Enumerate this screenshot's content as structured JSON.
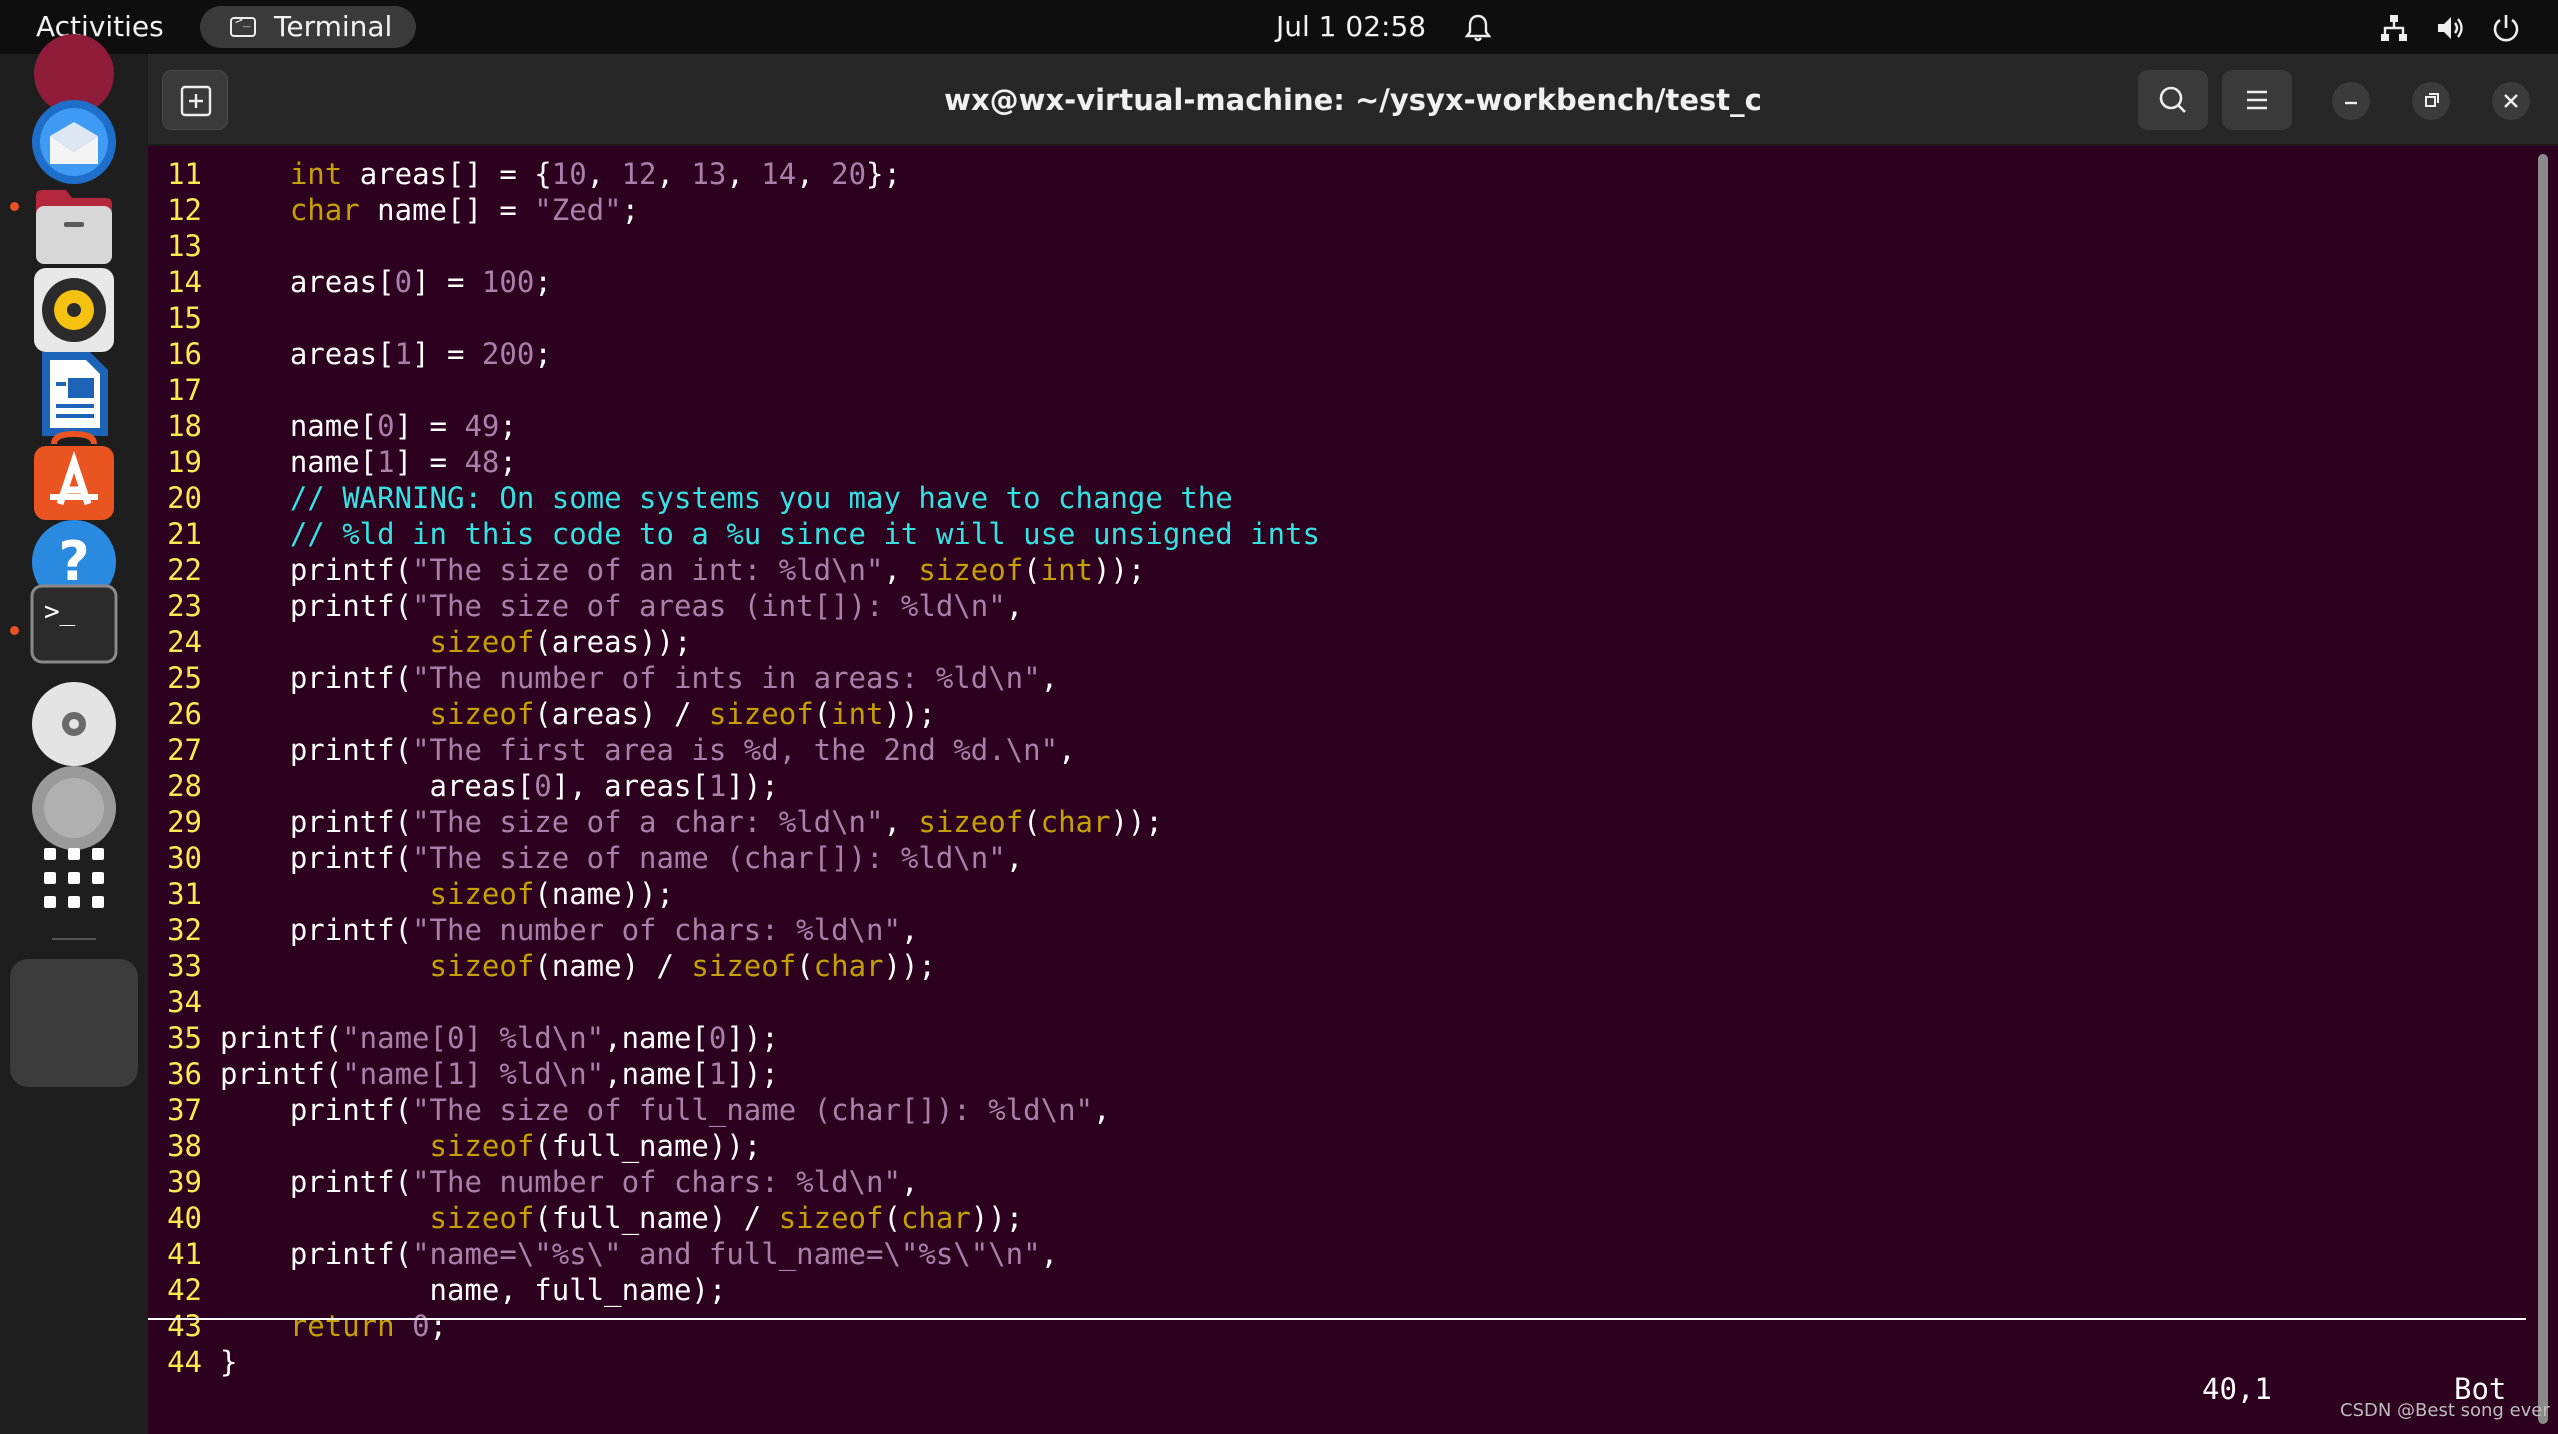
{
  "topbar": {
    "activities": "Activities",
    "app_name": "Terminal",
    "clock": "Jul 1  02:58"
  },
  "dock": {
    "apps": [
      "thunderbird-icon",
      "files-icon",
      "rhythmbox-icon",
      "libreoffice-writer-icon",
      "app-center-icon",
      "help-icon",
      "terminal-icon",
      "disc-icon",
      "disc-icon",
      "show-apps-icon"
    ]
  },
  "window": {
    "title": "wx@wx-virtual-machine: ~/ysyx-workbench/test_c"
  },
  "editor": {
    "lines": [
      {
        "n": "11",
        "tokens": [
          [
            "plain",
            "    "
          ],
          [
            "kw",
            "int"
          ],
          [
            "plain",
            " areas[] = {"
          ],
          [
            "num",
            "10"
          ],
          [
            "plain",
            ", "
          ],
          [
            "num",
            "12"
          ],
          [
            "plain",
            ", "
          ],
          [
            "num",
            "13"
          ],
          [
            "plain",
            ", "
          ],
          [
            "num",
            "14"
          ],
          [
            "plain",
            ", "
          ],
          [
            "num",
            "20"
          ],
          [
            "plain",
            "};"
          ]
        ]
      },
      {
        "n": "12",
        "tokens": [
          [
            "plain",
            "    "
          ],
          [
            "kw",
            "char"
          ],
          [
            "plain",
            " name[] = "
          ],
          [
            "str",
            "\"Zed\""
          ],
          [
            "plain",
            ";"
          ]
        ]
      },
      {
        "n": "13",
        "tokens": []
      },
      {
        "n": "14",
        "tokens": [
          [
            "plain",
            "    areas["
          ],
          [
            "num",
            "0"
          ],
          [
            "plain",
            "] = "
          ],
          [
            "num",
            "100"
          ],
          [
            "plain",
            ";"
          ]
        ]
      },
      {
        "n": "15",
        "tokens": []
      },
      {
        "n": "16",
        "tokens": [
          [
            "plain",
            "    areas["
          ],
          [
            "num",
            "1"
          ],
          [
            "plain",
            "] = "
          ],
          [
            "num",
            "200"
          ],
          [
            "plain",
            ";"
          ]
        ]
      },
      {
        "n": "17",
        "tokens": []
      },
      {
        "n": "18",
        "tokens": [
          [
            "plain",
            "    name["
          ],
          [
            "num",
            "0"
          ],
          [
            "plain",
            "] = "
          ],
          [
            "num",
            "49"
          ],
          [
            "plain",
            ";"
          ]
        ]
      },
      {
        "n": "19",
        "tokens": [
          [
            "plain",
            "    name["
          ],
          [
            "num",
            "1"
          ],
          [
            "plain",
            "] = "
          ],
          [
            "num",
            "48"
          ],
          [
            "plain",
            ";"
          ]
        ]
      },
      {
        "n": "20",
        "tokens": [
          [
            "plain",
            "    "
          ],
          [
            "cmt",
            "// WARNING: On some systems you may have to change the"
          ]
        ]
      },
      {
        "n": "21",
        "tokens": [
          [
            "plain",
            "    "
          ],
          [
            "cmt",
            "// %ld in this code to a %u since it will use unsigned ints"
          ]
        ]
      },
      {
        "n": "22",
        "tokens": [
          [
            "plain",
            "    printf("
          ],
          [
            "str",
            "\"The size of an int: %ld\\n\""
          ],
          [
            "plain",
            ", "
          ],
          [
            "fn",
            "sizeof"
          ],
          [
            "plain",
            "("
          ],
          [
            "kw",
            "int"
          ],
          [
            "plain",
            "));"
          ]
        ]
      },
      {
        "n": "23",
        "tokens": [
          [
            "plain",
            "    printf("
          ],
          [
            "str",
            "\"The size of areas (int[]): %ld\\n\""
          ],
          [
            "plain",
            ","
          ]
        ]
      },
      {
        "n": "24",
        "tokens": [
          [
            "plain",
            "            "
          ],
          [
            "fn",
            "sizeof"
          ],
          [
            "plain",
            "(areas));"
          ]
        ]
      },
      {
        "n": "25",
        "tokens": [
          [
            "plain",
            "    printf("
          ],
          [
            "str",
            "\"The number of ints in areas: %ld\\n\""
          ],
          [
            "plain",
            ","
          ]
        ]
      },
      {
        "n": "26",
        "tokens": [
          [
            "plain",
            "            "
          ],
          [
            "fn",
            "sizeof"
          ],
          [
            "plain",
            "(areas) / "
          ],
          [
            "fn",
            "sizeof"
          ],
          [
            "plain",
            "("
          ],
          [
            "kw",
            "int"
          ],
          [
            "plain",
            "));"
          ]
        ]
      },
      {
        "n": "27",
        "tokens": [
          [
            "plain",
            "    printf("
          ],
          [
            "str",
            "\"The first area is %d, the 2nd %d.\\n\""
          ],
          [
            "plain",
            ","
          ]
        ]
      },
      {
        "n": "28",
        "tokens": [
          [
            "plain",
            "            areas["
          ],
          [
            "num",
            "0"
          ],
          [
            "plain",
            "], areas["
          ],
          [
            "num",
            "1"
          ],
          [
            "plain",
            "]);"
          ]
        ]
      },
      {
        "n": "29",
        "tokens": [
          [
            "plain",
            "    printf("
          ],
          [
            "str",
            "\"The size of a char: %ld\\n\""
          ],
          [
            "plain",
            ", "
          ],
          [
            "fn",
            "sizeof"
          ],
          [
            "plain",
            "("
          ],
          [
            "kw",
            "char"
          ],
          [
            "plain",
            "));"
          ]
        ]
      },
      {
        "n": "30",
        "tokens": [
          [
            "plain",
            "    printf("
          ],
          [
            "str",
            "\"The size of name (char[]): %ld\\n\""
          ],
          [
            "plain",
            ","
          ]
        ]
      },
      {
        "n": "31",
        "tokens": [
          [
            "plain",
            "            "
          ],
          [
            "fn",
            "sizeof"
          ],
          [
            "plain",
            "(name));"
          ]
        ]
      },
      {
        "n": "32",
        "tokens": [
          [
            "plain",
            "    printf("
          ],
          [
            "str",
            "\"The number of chars: %ld\\n\""
          ],
          [
            "plain",
            ","
          ]
        ]
      },
      {
        "n": "33",
        "tokens": [
          [
            "plain",
            "            "
          ],
          [
            "fn",
            "sizeof"
          ],
          [
            "plain",
            "(name) / "
          ],
          [
            "fn",
            "sizeof"
          ],
          [
            "plain",
            "("
          ],
          [
            "kw",
            "char"
          ],
          [
            "plain",
            "));"
          ]
        ]
      },
      {
        "n": "34",
        "tokens": []
      },
      {
        "n": "35",
        "tokens": [
          [
            "plain",
            "printf("
          ],
          [
            "str",
            "\"name[0] %ld\\n\""
          ],
          [
            "plain",
            ",name["
          ],
          [
            "num",
            "0"
          ],
          [
            "plain",
            "]);"
          ]
        ]
      },
      {
        "n": "36",
        "tokens": [
          [
            "plain",
            "printf("
          ],
          [
            "str",
            "\"name[1] %ld\\n\""
          ],
          [
            "plain",
            ",name["
          ],
          [
            "num",
            "1"
          ],
          [
            "plain",
            "]);"
          ]
        ]
      },
      {
        "n": "37",
        "tokens": [
          [
            "plain",
            "    printf("
          ],
          [
            "str",
            "\"The size of full_name (char[]): %ld\\n\""
          ],
          [
            "plain",
            ","
          ]
        ]
      },
      {
        "n": "38",
        "tokens": [
          [
            "plain",
            "            "
          ],
          [
            "fn",
            "sizeof"
          ],
          [
            "plain",
            "(full_name));"
          ]
        ]
      },
      {
        "n": "39",
        "tokens": [
          [
            "plain",
            "    printf("
          ],
          [
            "str",
            "\"The number of chars: %ld\\n\""
          ],
          [
            "plain",
            ","
          ]
        ]
      },
      {
        "n": "40",
        "tokens": [
          [
            "plain",
            "            "
          ],
          [
            "fn",
            "sizeof"
          ],
          [
            "plain",
            "(full_name) / "
          ],
          [
            "fn",
            "sizeof"
          ],
          [
            "plain",
            "("
          ],
          [
            "kw",
            "char"
          ],
          [
            "plain",
            "));"
          ]
        ]
      },
      {
        "n": "41",
        "tokens": [
          [
            "plain",
            "    printf("
          ],
          [
            "str",
            "\"name=\\\"%s\\\" and full_name=\\\"%s\\\"\\n\""
          ],
          [
            "plain",
            ","
          ]
        ]
      },
      {
        "n": "42",
        "tokens": [
          [
            "plain",
            "            name, full_name);"
          ]
        ]
      },
      {
        "n": "43",
        "tokens": [
          [
            "plain",
            "    "
          ],
          [
            "kw",
            "return"
          ],
          [
            "plain",
            " "
          ],
          [
            "num",
            "0"
          ],
          [
            "plain",
            ";"
          ]
        ]
      },
      {
        "n": "44",
        "tokens": [
          [
            "plain",
            "}"
          ]
        ]
      }
    ],
    "status_position": "40,1",
    "status_scroll": "Bot"
  },
  "watermark": "CSDN @Best song ever",
  "colors": {
    "background": "#2c001e",
    "line_number": "#fce94f",
    "keyword": "#c4a000",
    "constant": "#ad7fa8",
    "comment": "#34e2e2"
  }
}
